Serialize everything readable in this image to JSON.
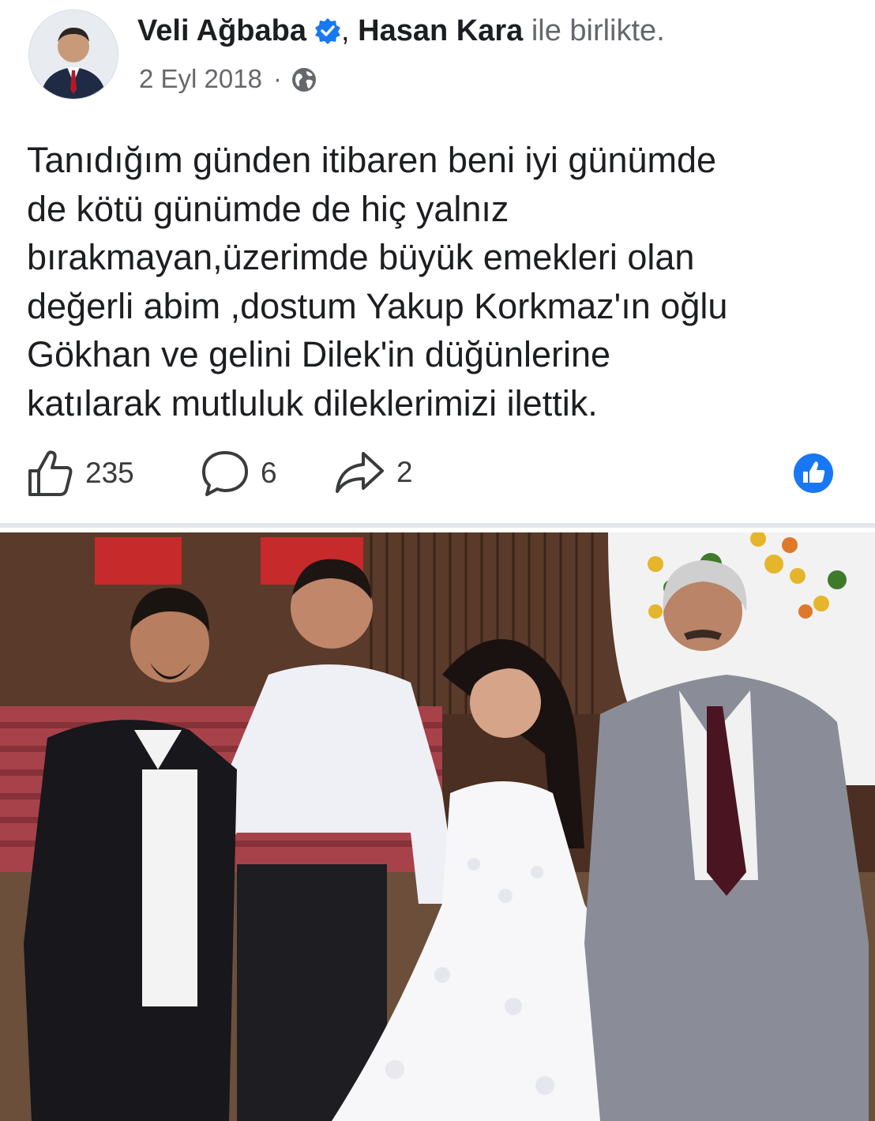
{
  "post": {
    "author": "Veli Ağbaba",
    "separator": ",",
    "tagged": "Hasan Kara",
    "with_text": "ile birlikte.",
    "date": "2 Eyl 2018",
    "dot": "·",
    "audience_icon": "globe-icon",
    "verified_icon": "verified-badge-icon",
    "text": "Tanıdığım günden itibaren beni iyi günümde\nde kötü günümde de hiç yalnız\nbırakmayan,üzerimde büyük emekleri olan\ndeğerli abim ,dostum Yakup Korkmaz'ın oğlu\nGökhan ve gelini Dilek'in düğünlerine\nkatılarak mutluluk dileklerimizi ilettik."
  },
  "actions": {
    "likes": "235",
    "comments": "6",
    "shares": "2",
    "like_icon": "thumbs-up-icon",
    "comment_icon": "comment-bubble-icon",
    "share_icon": "share-arrow-icon",
    "reaction_icon": "like-reaction-icon"
  },
  "colors": {
    "accent": "#1877f2",
    "text_primary": "#1c1e21",
    "text_secondary": "#65676b",
    "divider": "#e4e6eb"
  }
}
